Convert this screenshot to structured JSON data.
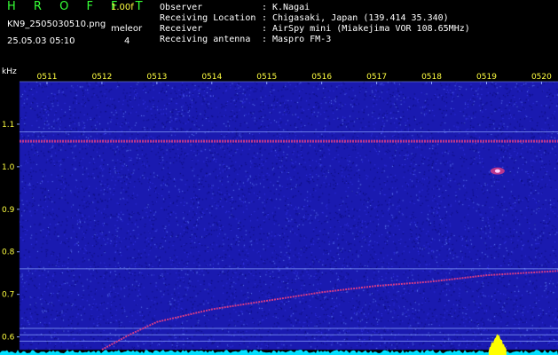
{
  "header": {
    "app_title": "H R O F F T",
    "version": "1.00f",
    "filename": "KN9_2505030510.png",
    "mode_label": "meleor",
    "mode_value": "4",
    "datetime": "25.05.03 05:10",
    "info": [
      {
        "key": "Observer",
        "value": "K.Nagai"
      },
      {
        "key": "Receiving Location",
        "value": "Chigasaki, Japan (139.414 35.340)"
      },
      {
        "key": "Receiver",
        "value": "AirSpy mini (Miakejima VOR 108.65MHz)"
      },
      {
        "key": "Receiving antenna",
        "value": "Maspro FM-3"
      }
    ],
    "separator": ":"
  },
  "colors": {
    "background": "#000000",
    "plot_bg": "#1a1ab0",
    "title": "#36ff36",
    "version": "#ffff40",
    "text": "#ffffff",
    "axis_text": "#ffff40",
    "band": "#cc3a8a",
    "baseline": "#00e0ff",
    "burst": "#ffff00"
  },
  "chart_data": {
    "type": "heatmap",
    "y_unit": "kHz",
    "time_ticks": [
      "0511",
      "0512",
      "0513",
      "0514",
      "0515",
      "0516",
      "0517",
      "0518",
      "0519",
      "0520"
    ],
    "freq_ticks": [
      1.1,
      1.0,
      0.9,
      0.8,
      0.7,
      0.6
    ],
    "ylim": [
      0.57,
      1.2
    ],
    "xlim_minutes": [
      10.5,
      20.3
    ],
    "carrier_freq": 1.06,
    "horizontal_lines": [
      1.082,
      1.06,
      0.76,
      0.62,
      0.605,
      0.59
    ],
    "drift_trace": [
      {
        "t": 12.0,
        "f": 0.57
      },
      {
        "t": 12.5,
        "f": 0.605
      },
      {
        "t": 13.0,
        "f": 0.635
      },
      {
        "t": 14.0,
        "f": 0.665
      },
      {
        "t": 15.0,
        "f": 0.685
      },
      {
        "t": 16.0,
        "f": 0.705
      },
      {
        "t": 17.0,
        "f": 0.72
      },
      {
        "t": 18.0,
        "f": 0.73
      },
      {
        "t": 19.0,
        "f": 0.745
      },
      {
        "t": 20.3,
        "f": 0.755
      }
    ],
    "echo": {
      "t": 19.2,
      "f": 0.99
    },
    "burst_time": 19.2
  }
}
